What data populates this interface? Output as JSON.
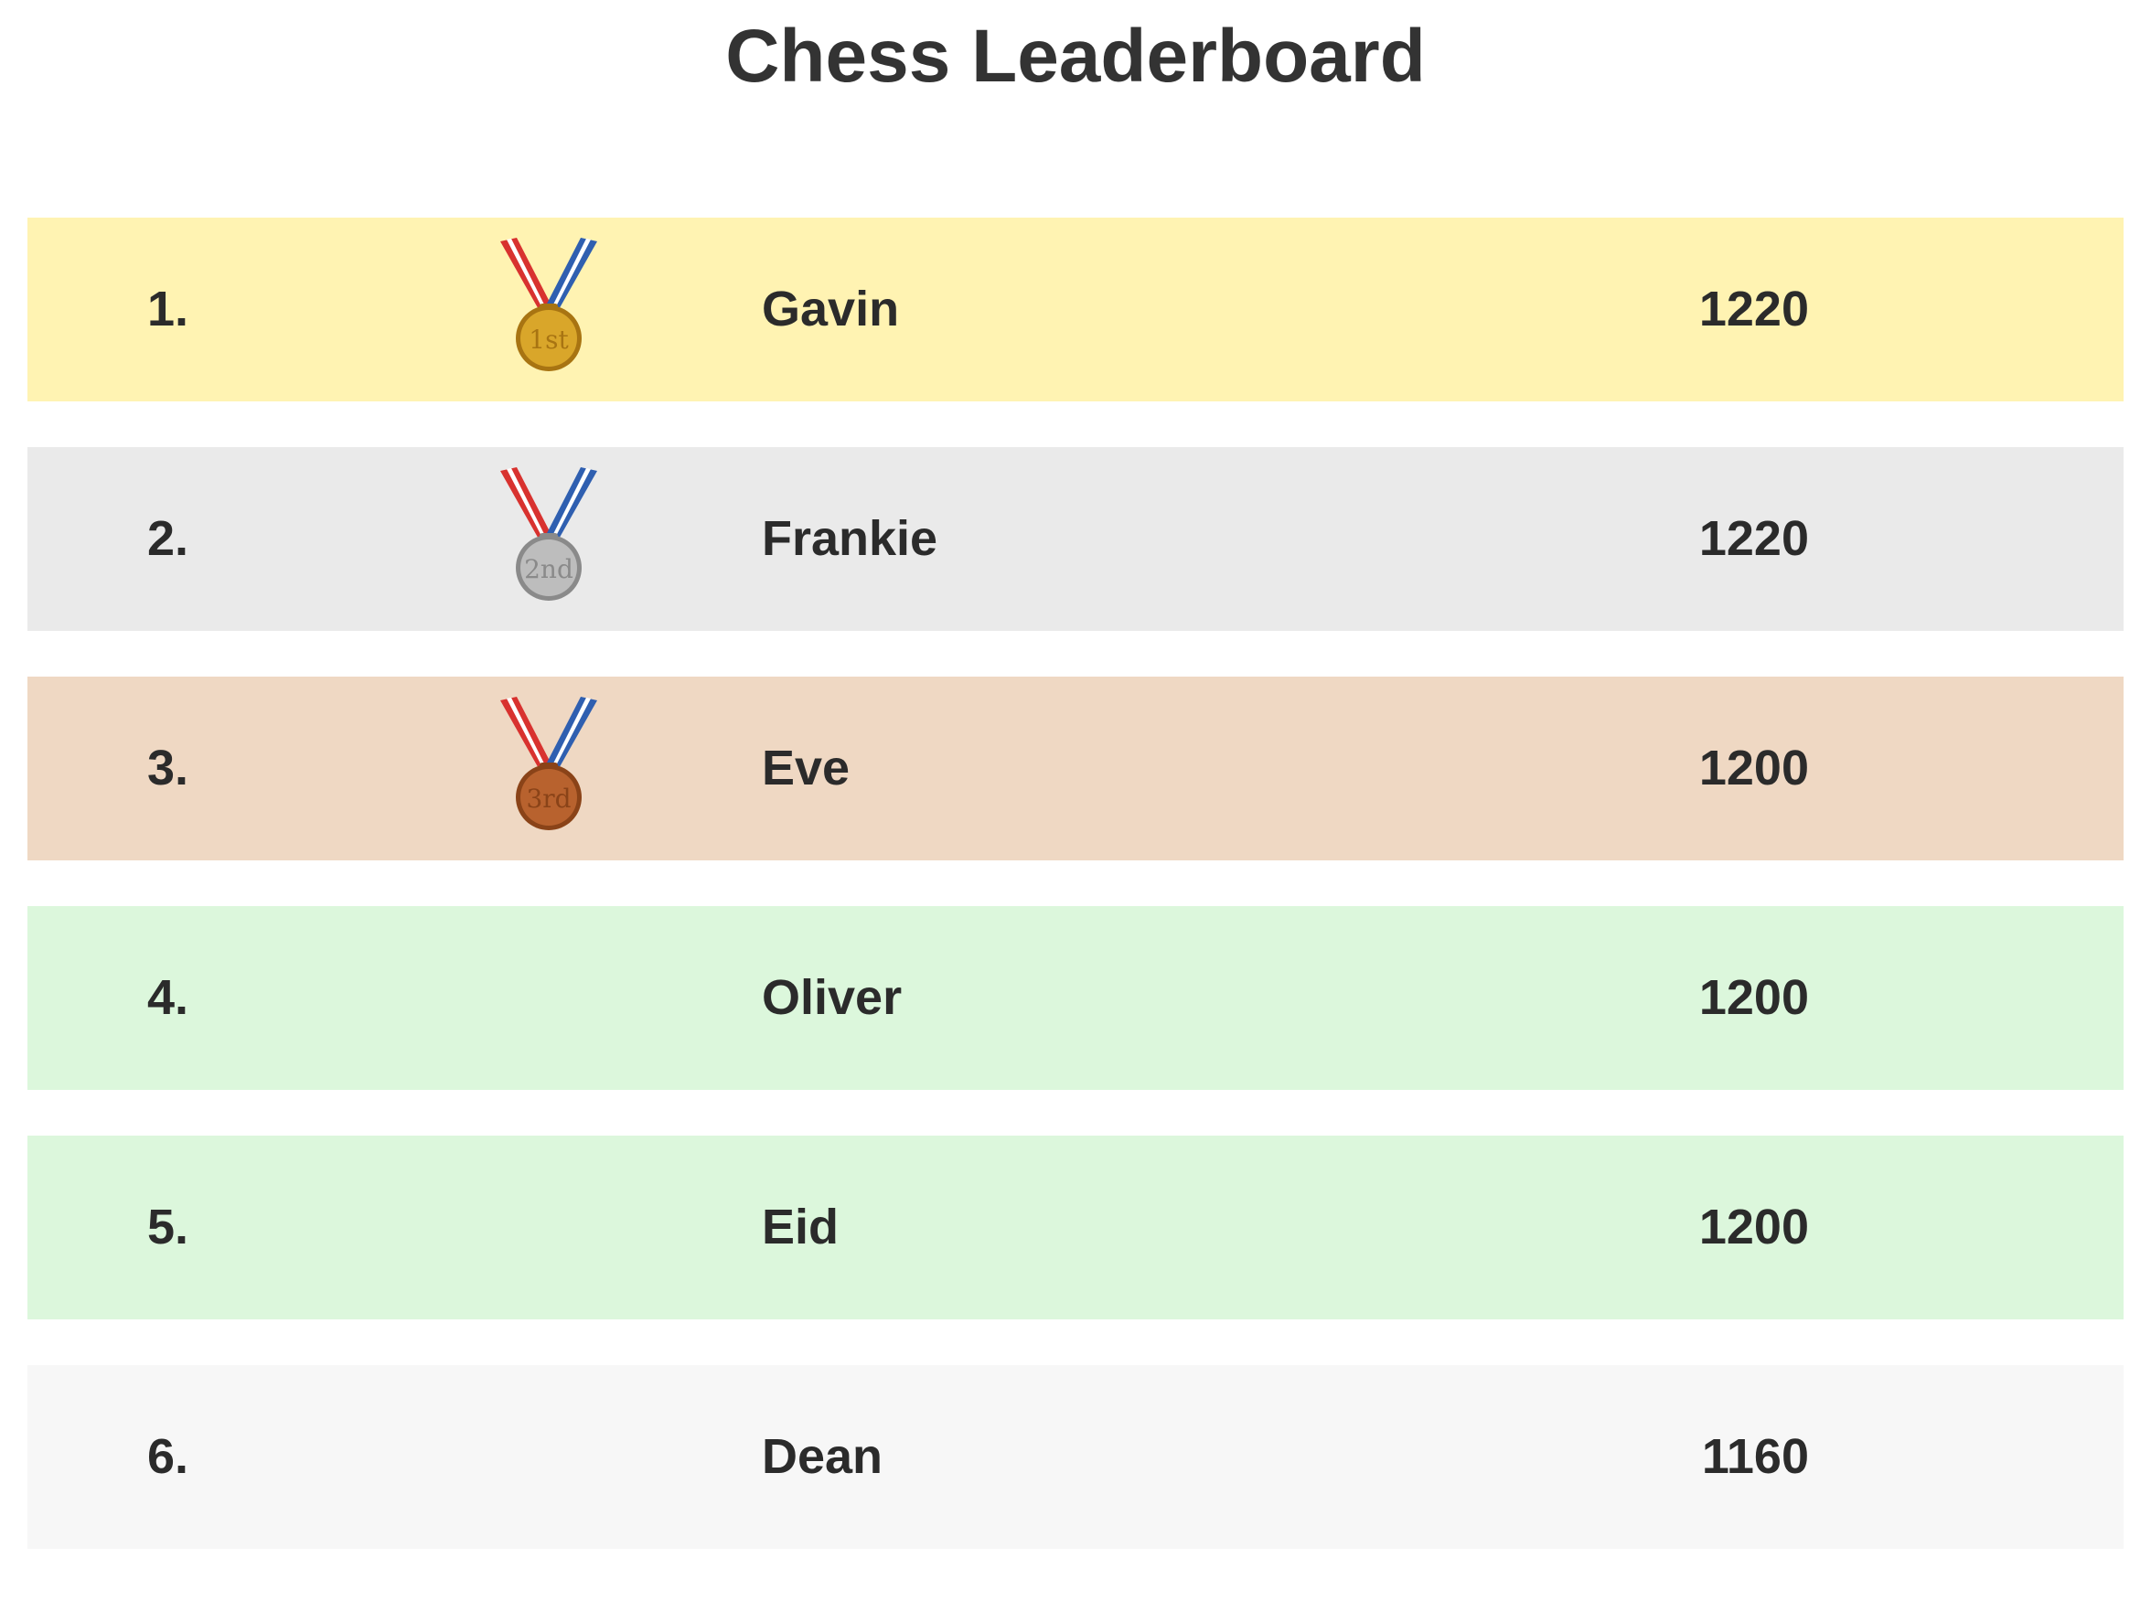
{
  "title": "Chess Leaderboard",
  "rows": [
    {
      "rank": "1.",
      "name": "Gavin",
      "score": "1220",
      "bg": "#fff3b2",
      "medal": {
        "label": "1st",
        "color": "#d9a62a",
        "edge": "#a87412"
      }
    },
    {
      "rank": "2.",
      "name": "Frankie",
      "score": "1220",
      "bg": "#eaeaea",
      "medal": {
        "label": "2nd",
        "color": "#bdbdbd",
        "edge": "#8a8a8a"
      }
    },
    {
      "rank": "3.",
      "name": "Eve",
      "score": "1200",
      "bg": "#efd8c3",
      "medal": {
        "label": "3rd",
        "color": "#b8622e",
        "edge": "#8a4318"
      }
    },
    {
      "rank": "4.",
      "name": "Oliver",
      "score": "1200",
      "bg": "#dcf7dc",
      "medal": null
    },
    {
      "rank": "5.",
      "name": "Eid",
      "score": "1200",
      "bg": "#dcf7dc",
      "medal": null
    },
    {
      "rank": "6.",
      "name": "Dean",
      "score": "1160",
      "bg": "#f7f7f7",
      "medal": null
    }
  ]
}
